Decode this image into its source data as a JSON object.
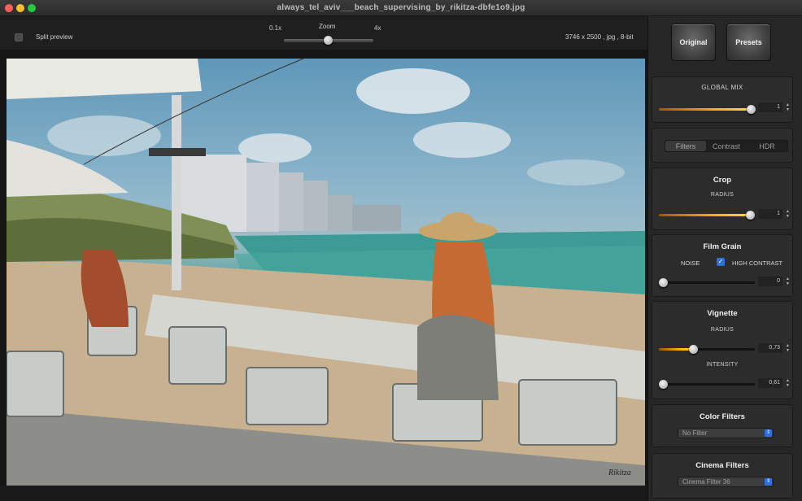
{
  "window": {
    "title": "always_tel_aviv___beach_supervising_by_rikitza-dbfe1o9.jpg"
  },
  "toolbar": {
    "split_preview_label": "Split preview",
    "zoom_label": "Zoom",
    "zoom_min": "0.1x",
    "zoom_max": "4x",
    "image_info": "3746 x 2500 , jpg , 8-bit"
  },
  "photo": {
    "signature": "Rikitza"
  },
  "panel": {
    "original_label": "Original",
    "presets_label": "Presets",
    "global_mix": {
      "title": "GLOBAL MIX",
      "value": "1",
      "fraction": 0.92
    },
    "tabs": [
      "Filters",
      "Contrast",
      "HDR"
    ],
    "active_tab": "Filters",
    "crop": {
      "title": "Crop",
      "radius_label": "RADIUS",
      "radius_value": "1",
      "fraction": 0.92
    },
    "film_grain": {
      "title": "Film Grain",
      "noise_label": "NOISE",
      "high_contrast_label": "HIGH CONTRAST",
      "high_contrast_checked": true,
      "value": "0",
      "fraction": 0.0
    },
    "vignette": {
      "title": "Vignette",
      "radius_label": "RADIUS",
      "radius_value": "0,73",
      "radius_fraction": 0.36,
      "intensity_label": "INTENSITY",
      "intensity_value": "0,61",
      "intensity_fraction": 0.0
    },
    "color_filters": {
      "title": "Color Filters",
      "selected": "No Filter"
    },
    "cinema_filters": {
      "title": "Cinema Filters",
      "selected": "Cinema Filter 36"
    }
  },
  "colors": {
    "accent": "#f0b400",
    "checkbox": "#2e6fd9"
  }
}
